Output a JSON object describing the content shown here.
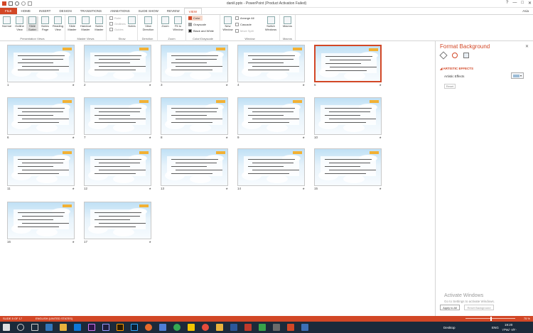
{
  "window": {
    "title": "daniil.pptx - PowerPoint (Product Activation Failed)",
    "controls": [
      "?",
      "—",
      "□",
      "✕"
    ]
  },
  "ribbon_tabs": [
    "FILE",
    "HOME",
    "INSERT",
    "DESIGN",
    "TRANSITIONS",
    "ANIMATIONS",
    "SLIDE SHOW",
    "REVIEW",
    "VIEW"
  ],
  "active_tab": "VIEW",
  "user": "Asia",
  "ribbon": {
    "presentation_views": {
      "label": "Presentation Views",
      "buttons": [
        "Normal",
        "Outline View",
        "Slide Sorter",
        "Notes Page",
        "Reading View"
      ]
    },
    "master_views": {
      "label": "Master Views",
      "buttons": [
        "Slide Master",
        "Handout Master",
        "Notes Master"
      ]
    },
    "show": {
      "label": "Show",
      "items": [
        "Ruler",
        "Gridlines",
        "Guides"
      ],
      "notes": "Notes"
    },
    "direction": {
      "label": "Direction",
      "button": "View Direction"
    },
    "zoom": {
      "label": "Zoom",
      "buttons": [
        "Zoom",
        "Fit to Window"
      ]
    },
    "color": {
      "label": "Color/Grayscale",
      "items": [
        "Color",
        "Grayscale",
        "Black and White"
      ]
    },
    "window": {
      "label": "Window",
      "new_window": "New Window",
      "items": [
        "Arrange All",
        "Cascade",
        "Move Split"
      ],
      "switch": "Switch Windows"
    },
    "macros": {
      "label": "Macros",
      "button": "Macros"
    }
  },
  "slides": [
    {
      "num": "1"
    },
    {
      "num": "2"
    },
    {
      "num": "3"
    },
    {
      "num": "4"
    },
    {
      "num": "5",
      "selected": true
    },
    {
      "num": "6"
    },
    {
      "num": "7"
    },
    {
      "num": "8"
    },
    {
      "num": "9"
    },
    {
      "num": "10"
    },
    {
      "num": "11"
    },
    {
      "num": "12"
    },
    {
      "num": "13"
    },
    {
      "num": "14"
    },
    {
      "num": "15"
    },
    {
      "num": "16"
    },
    {
      "num": "17"
    }
  ],
  "slide_star": "★",
  "format_pane": {
    "title": "Format Background",
    "close": "✕",
    "section": "ARTISTIC EFFECTS",
    "field_label": "Artistic Effects",
    "reset": "Reset",
    "apply_all": "Apply to All",
    "reset_background": "Reset Background",
    "watermark_title": "Activate Windows",
    "watermark_sub": "Go to Settings to activate Windows."
  },
  "statusbar": {
    "slide": "SLIDE 5 OF 17",
    "language": "ENGLISH (UNITED STATES)",
    "zoom": "75 %"
  },
  "taskbar": {
    "desktop_label": "Desktop",
    "language": "ENG",
    "time": "19:20",
    "date": "۱۳۹۸/۰۷/۲۰"
  },
  "colors": {
    "accent": "#d24726",
    "taskbar": "#1c2a3a"
  }
}
